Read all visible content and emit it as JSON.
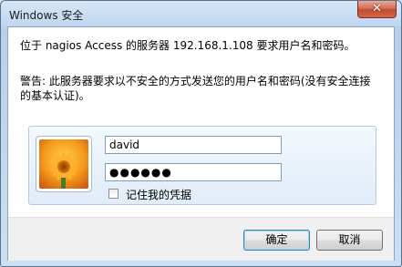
{
  "window": {
    "title": "Windows 安全",
    "close_label": "✕"
  },
  "message": {
    "server_line": "位于 nagios Access 的服务器 192.168.1.108 要求用户名和密码。",
    "warning": "警告: 此服务器要求以不安全的方式发送您的用户名和密码(没有安全连接的基本认证)。"
  },
  "credentials": {
    "username": "david",
    "password_mask": "●●●●●●",
    "remember_label": "记住我的凭据",
    "remember_checked": false
  },
  "buttons": {
    "ok_label": "确定",
    "cancel_label": "取消"
  },
  "colors": {
    "title_bar": "#c4d9ef",
    "close_button": "#c14a32",
    "panel_bg": "#e0ecf8",
    "footer_bg": "#f0f0f0",
    "accent": "#3c7fb1"
  },
  "icons": {
    "user_tile": "flower-avatar-icon",
    "close": "close-icon"
  }
}
